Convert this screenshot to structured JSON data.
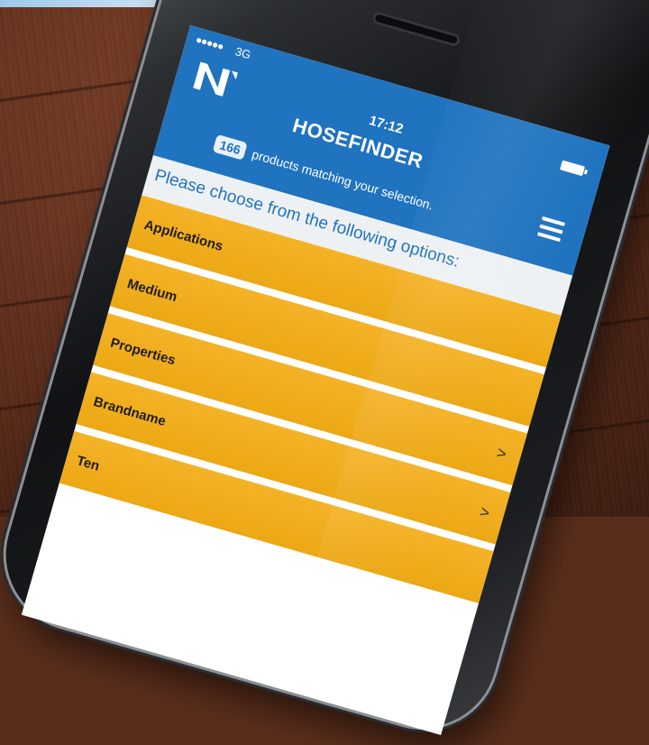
{
  "status_bar": {
    "signal": "●●●●●",
    "network": "3G",
    "time": "17:12"
  },
  "app": {
    "title": "HOSEFINDER",
    "product_count": "166",
    "products_text": "products matching your selection.",
    "instruction": "Please choose from the following options:"
  },
  "options": [
    {
      "label": "Applications",
      "chevron": ""
    },
    {
      "label": "Medium",
      "chevron": ""
    },
    {
      "label": "Properties",
      "chevron": ">"
    },
    {
      "label": "Brandname",
      "chevron": ">"
    },
    {
      "label": "Ten",
      "chevron": ""
    }
  ],
  "icons": {
    "logo": "brand-logo-icon",
    "menu": "hamburger-menu-icon"
  },
  "colors": {
    "header_blue": "#1f73bf",
    "option_orange": "#f0aa1c",
    "instruction_bg": "#eef1f3"
  }
}
